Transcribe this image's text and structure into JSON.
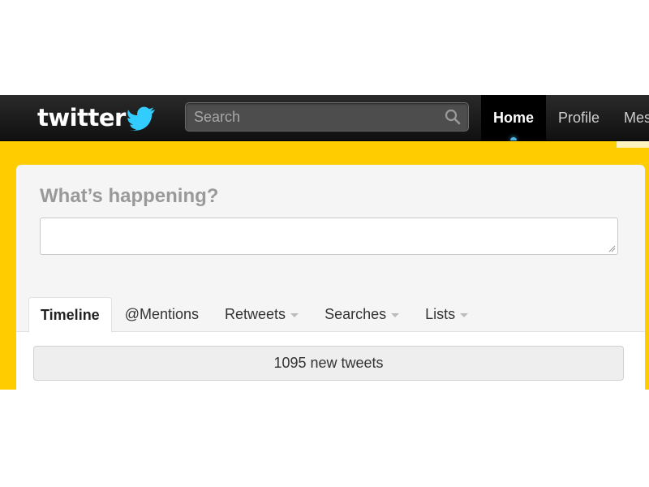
{
  "header": {
    "logo_text": "twitter",
    "search": {
      "placeholder": "Search",
      "value": ""
    },
    "nav": [
      {
        "label": "Home",
        "active": true
      },
      {
        "label": "Profile",
        "active": false
      },
      {
        "label": "Mes",
        "active": false
      }
    ]
  },
  "composer": {
    "prompt": "What’s happening?",
    "value": ""
  },
  "tabs": [
    {
      "label": "Timeline",
      "active": true,
      "dropdown": false
    },
    {
      "label": "@Mentions",
      "active": false,
      "dropdown": false
    },
    {
      "label": "Retweets",
      "active": false,
      "dropdown": true
    },
    {
      "label": "Searches",
      "active": false,
      "dropdown": true
    },
    {
      "label": "Lists",
      "active": false,
      "dropdown": true
    }
  ],
  "timeline": {
    "new_tweets_label": "1095 new tweets"
  },
  "icons": {
    "logo": "twitter-bird-icon",
    "search": "search-icon",
    "dropdown": "caret-down-icon"
  },
  "colors": {
    "topbar": "#1a1a1a",
    "background": "#ffcc00",
    "brand_blue": "#33ccff",
    "panel": "#f5f5f5"
  }
}
